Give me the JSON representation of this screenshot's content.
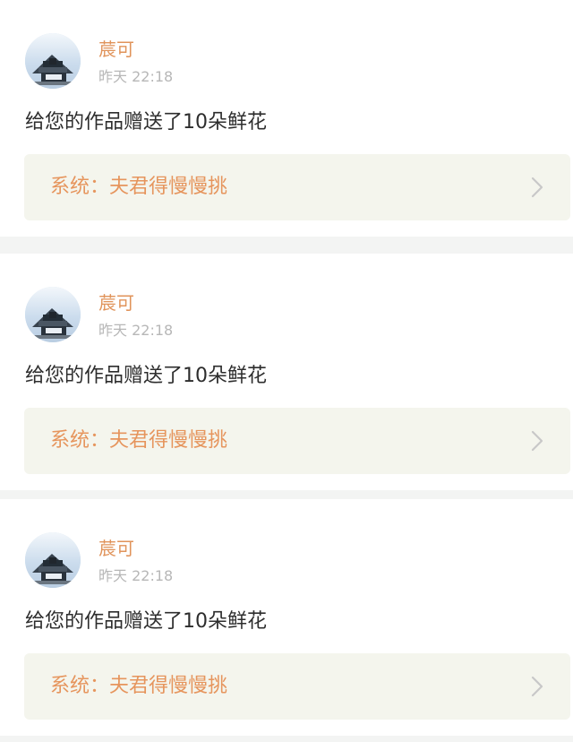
{
  "notifications": [
    {
      "username": "莀可",
      "time": "昨天 22:18",
      "message": "给您的作品赠送了10朵鲜花",
      "work_link": "系统：夫君得慢慢挑"
    },
    {
      "username": "莀可",
      "time": "昨天 22:18",
      "message": "给您的作品赠送了10朵鲜花",
      "work_link": "系统：夫君得慢慢挑"
    },
    {
      "username": "莀可",
      "time": "昨天 22:18",
      "message": "给您的作品赠送了10朵鲜花",
      "work_link": "系统：夫君得慢慢挑"
    }
  ],
  "icons": {
    "avatar": "building-avatar-icon",
    "chevron": "chevron-right-icon"
  },
  "colors": {
    "username": "#e0935a",
    "time": "#b7b7b7",
    "message": "#2d2d2d",
    "work_link_text": "#e6955d",
    "work_link_background": "#f4f5ed",
    "page_background": "#f3f4f3"
  }
}
